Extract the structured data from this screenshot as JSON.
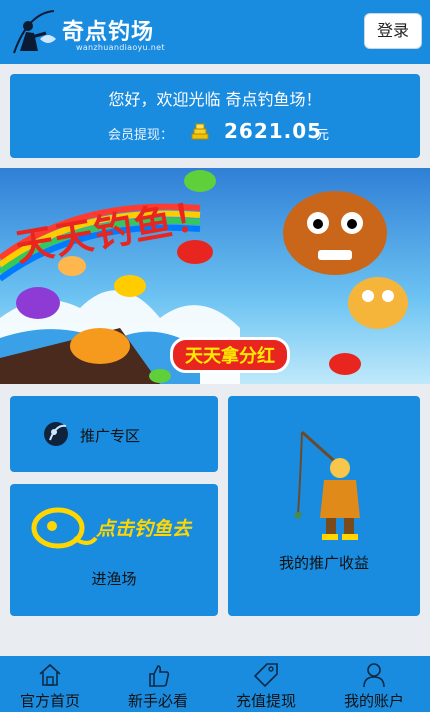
{
  "header": {
    "brand": "奇点钓场",
    "brand_sub": "wanzhuandiaoyu.net",
    "login_label": "登录"
  },
  "welcome": {
    "greeting": "您好，欢迎光临 奇点钓鱼场！",
    "balance_label": "会员提现：",
    "balance_amount": "2621.05",
    "balance_unit": "元"
  },
  "banner": {
    "title": "天天钓鱼！",
    "tagline": "天天拿分红"
  },
  "cards": {
    "promo_label": "推广专区",
    "enter_cta": "点击钓鱼去",
    "enter_label": "进渔场",
    "earnings_label": "我的推广收益"
  },
  "bottom_nav": [
    {
      "label": "官方首页",
      "icon": "home-icon"
    },
    {
      "label": "新手必看",
      "icon": "thumbs-up-icon"
    },
    {
      "label": "充值提现",
      "icon": "tag-icon"
    },
    {
      "label": "我的账户",
      "icon": "user-icon"
    }
  ],
  "colors": {
    "primary": "#1a8ce0",
    "background": "#e9edf1",
    "banner_red": "#e8261f",
    "accent_yellow": "#ffd600"
  }
}
